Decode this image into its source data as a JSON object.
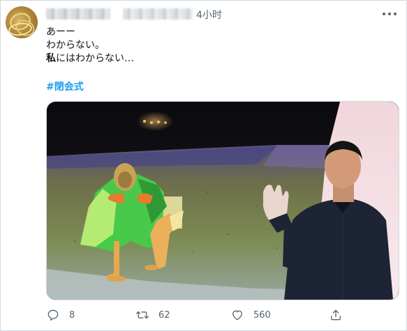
{
  "tweet": {
    "timestamp": "4小时",
    "lines": [
      "あーー",
      "わからない。"
    ],
    "line3_bold": "私",
    "line3_rest": "にはわからない…",
    "hashtag": "#閉会式"
  },
  "actions": {
    "reply_count": "8",
    "retweet_count": "62",
    "like_count": "560"
  },
  "icons": {
    "more": "more-horizontal-icon",
    "reply": "reply-icon",
    "retweet": "retweet-icon",
    "like": "heart-icon",
    "share": "share-icon"
  },
  "colors": {
    "hashtag": "#1d9bf0",
    "secondary_text": "#536471",
    "primary_text": "#0f1419"
  }
}
